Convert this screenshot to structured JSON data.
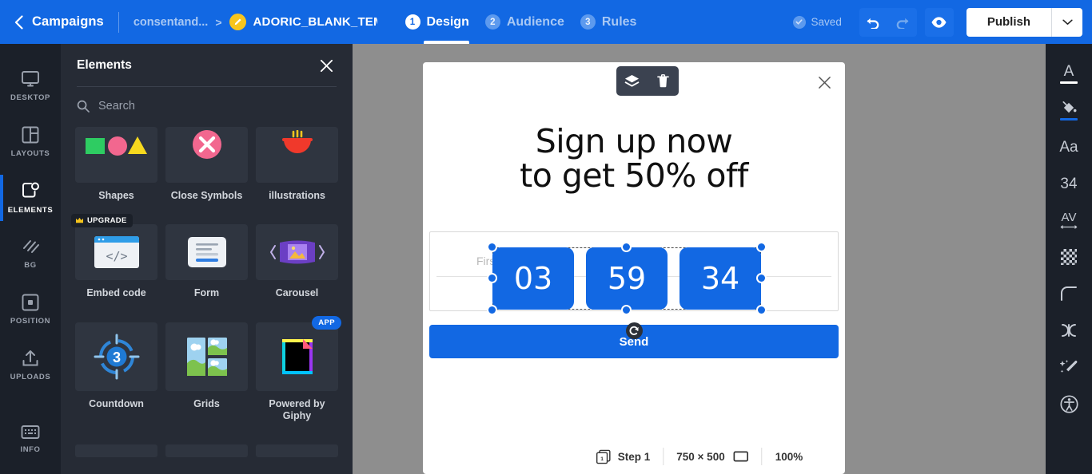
{
  "header": {
    "back_label": "Campaigns",
    "breadcrumb_parent": "consentand...",
    "breadcrumb_arrow": ">",
    "breadcrumb_current": "ADORIC_BLANK_TEMPL",
    "steps": [
      {
        "num": "1",
        "label": "Design",
        "state": "active"
      },
      {
        "num": "2",
        "label": "Audience",
        "state": "idle"
      },
      {
        "num": "3",
        "label": "Rules",
        "state": "idle"
      }
    ],
    "saved_label": "Saved",
    "undo_icon": "undo-icon",
    "redo_icon": "redo-icon",
    "preview_icon": "eye-icon",
    "publish_label": "Publish",
    "publish_caret_icon": "chevron-down-icon"
  },
  "rail": {
    "items": [
      {
        "label": "DESKTOP",
        "icon": "monitor-icon",
        "active": false
      },
      {
        "label": "LAYOUTS",
        "icon": "layouts-icon",
        "active": false
      },
      {
        "label": "ELEMENTS",
        "icon": "elements-icon",
        "active": true
      },
      {
        "label": "BG",
        "icon": "background-hatch-icon",
        "active": false
      },
      {
        "label": "POSITION",
        "icon": "position-square-icon",
        "active": false
      },
      {
        "label": "UPLOADS",
        "icon": "upload-icon",
        "active": false
      },
      {
        "label": "INFO",
        "icon": "keyboard-info-icon",
        "active": false
      }
    ]
  },
  "panel": {
    "title": "Elements",
    "close_icon": "close-icon",
    "search_placeholder": "Search",
    "search_value": "",
    "tiles": [
      {
        "label": "Shapes",
        "icon": "shapes-icon",
        "badge": ""
      },
      {
        "label": "Close Symbols",
        "icon": "close-symbols-icon",
        "badge": ""
      },
      {
        "label": "illustrations",
        "icon": "illustrations-bowl-icon",
        "badge": ""
      },
      {
        "label": "Embed code",
        "icon": "embed-code-icon",
        "badge": "UPGRADE"
      },
      {
        "label": "Form",
        "icon": "form-icon",
        "badge": ""
      },
      {
        "label": "Carousel",
        "icon": "carousel-icon",
        "badge": ""
      },
      {
        "label": "Countdown",
        "icon": "countdown-icon",
        "badge": ""
      },
      {
        "label": "Grids",
        "icon": "grids-icon",
        "badge": ""
      },
      {
        "label": "Powered by Giphy",
        "icon": "giphy-icon",
        "badge": "APP"
      }
    ]
  },
  "canvas": {
    "close_icon": "close-icon",
    "headline_line1": "Sign up now",
    "headline_line2": "to get 50% off",
    "form_placeholder": "First name",
    "send_label": "Send",
    "countdown": [
      "03",
      "59",
      "34"
    ],
    "selection_toolbar": {
      "layers_icon": "layers-icon",
      "delete_icon": "trash-icon"
    },
    "rotate_icon": "rotate-icon"
  },
  "status": {
    "step_icon": "pages-icon",
    "step_label": "Step 1",
    "dimensions": "750 × 500",
    "screen_icon": "screen-icon",
    "zoom": "100%"
  },
  "right_toolbar": {
    "items": [
      {
        "name": "text-color",
        "glyph": "A",
        "underline": "white"
      },
      {
        "name": "fill-color",
        "glyph": "paint-bucket-icon",
        "underline": "blue"
      },
      {
        "name": "font-family",
        "glyph": "Aa",
        "underline": ""
      },
      {
        "name": "font-size",
        "glyph": "34",
        "underline": ""
      },
      {
        "name": "letter-spacing",
        "glyph": "AV",
        "underline": ""
      },
      {
        "name": "opacity",
        "glyph": "checker-icon",
        "underline": ""
      },
      {
        "name": "border-radius",
        "glyph": "corner-radius-icon",
        "underline": ""
      },
      {
        "name": "padding",
        "glyph": "padding-icon",
        "underline": ""
      },
      {
        "name": "effects",
        "glyph": "magic-wand-icon",
        "underline": ""
      },
      {
        "name": "accessibility",
        "glyph": "accessibility-icon",
        "underline": ""
      }
    ]
  },
  "colors": {
    "brand_blue": "#1268e3",
    "panel_dark": "#262b35",
    "rail_dark": "#1b2029",
    "canvas_gray": "#8e8e8e",
    "badge_yellow": "#f8c51c"
  }
}
